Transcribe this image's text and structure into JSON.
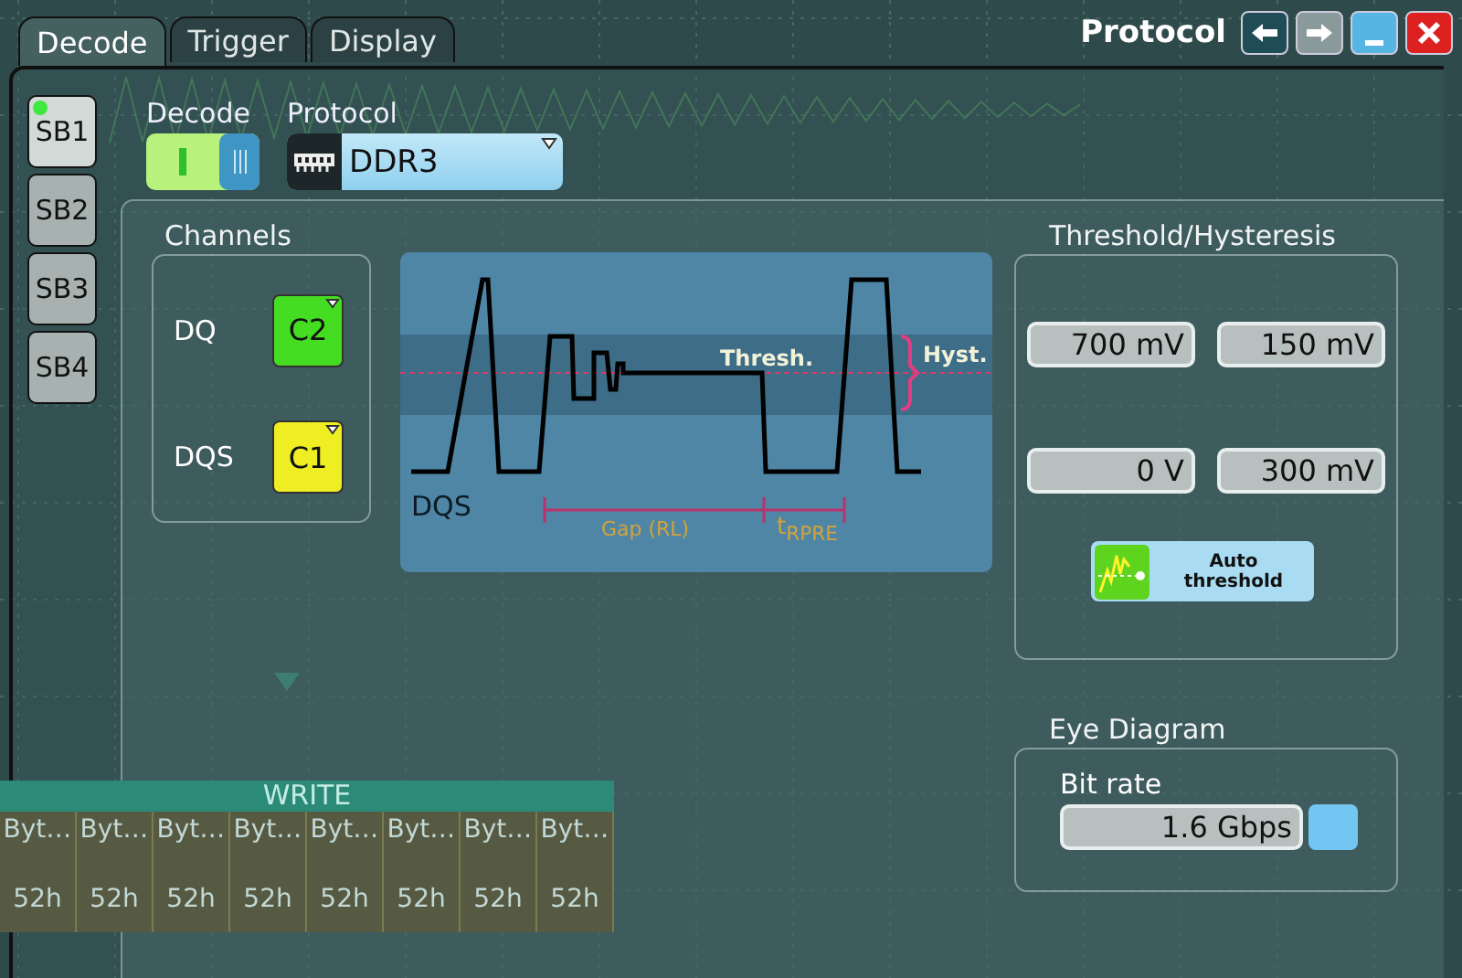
{
  "tabs": [
    {
      "label": "Decode",
      "selected": true
    },
    {
      "label": "Trigger",
      "selected": false
    },
    {
      "label": "Display",
      "selected": false
    }
  ],
  "window": {
    "title": "Protocol",
    "back_disabled": false,
    "forward_disabled": true
  },
  "side_tabs": [
    {
      "label": "SB1",
      "selected": true,
      "active": true
    },
    {
      "label": "SB2",
      "selected": false,
      "active": false
    },
    {
      "label": "SB3",
      "selected": false,
      "active": false
    },
    {
      "label": "SB4",
      "selected": false,
      "active": false
    }
  ],
  "decode": {
    "label": "Decode",
    "on": true
  },
  "protocol": {
    "label": "Protocol",
    "value": "DDR3"
  },
  "channels": {
    "title": "Channels",
    "items": [
      {
        "label": "DQ",
        "source": "C2",
        "color": "#44dd22"
      },
      {
        "label": "DQS",
        "source": "C1",
        "color": "#eeee22"
      }
    ]
  },
  "diagram": {
    "signal": "DQS",
    "thresh": "Thresh.",
    "hyst": "Hyst.",
    "gap": "Gap (RL)",
    "preamble": "t$_{RPRE}$"
  },
  "threshold": {
    "title": "Threshold/Hysteresis",
    "rows": [
      [
        "700 mV",
        "150 mV"
      ],
      [
        "0 V",
        "300 mV"
      ]
    ],
    "auto": "Auto threshold"
  },
  "eye": {
    "title": "Eye Diagram",
    "label": "Bit rate",
    "value": "1.6 Gbps"
  },
  "background_bus": {
    "label": "WRITE",
    "frames": [
      {
        "name": "Byt…",
        "value": "52h"
      },
      {
        "name": "Byt…",
        "value": "52h"
      },
      {
        "name": "Byt…",
        "value": "52h"
      },
      {
        "name": "Byt…",
        "value": "52h"
      },
      {
        "name": "Byt…",
        "value": "52h"
      },
      {
        "name": "Byt…",
        "value": "52h"
      },
      {
        "name": "Byt…",
        "value": "52h"
      },
      {
        "name": "Byt…",
        "value": "52h"
      }
    ]
  }
}
